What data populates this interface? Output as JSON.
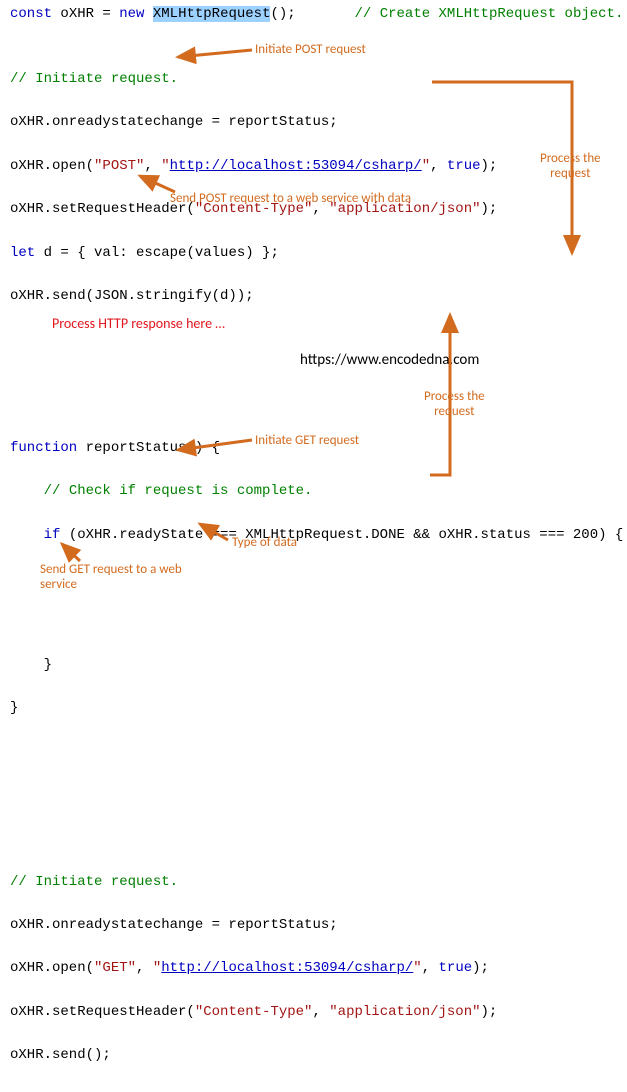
{
  "code": {
    "l1a": "const",
    "l1b": " oXHR = ",
    "l1c": "new",
    "l1d": " ",
    "l1e": "XMLHttpRequest",
    "l1f": "();",
    "l1g": "// Create XMLHttpRequest object.",
    "l3": "// Initiate request.",
    "l4": "oXHR.onreadystatechange = reportStatus;",
    "l5a": "oXHR.open(",
    "l5b": "\"POST\"",
    "l5c": ", ",
    "l5d": "\"",
    "l5url": "http://localhost:53094/csharp/",
    "l5e": "\"",
    "l5f": ", ",
    "l5g": "true",
    "l5h": ");",
    "l6a": "oXHR.setRequestHeader(",
    "l6b": "\"Content-Type\"",
    "l6c": ", ",
    "l6d": "\"application/json\"",
    "l6e": ");",
    "l7a": "let",
    "l7b": " d = { val: escape(values) };",
    "l8": "oXHR.send(JSON.stringify(d));",
    "l10a": "function",
    "l10b": " reportStatus() {",
    "l11": "// Check if request is complete.",
    "l12a": "if",
    "l12b": " (oXHR.readyState === XMLHttpRequest.DONE && oXHR.status === 200) {",
    "l15": "}",
    "l16": "}",
    "l20": "// Initiate request.",
    "l21": "oXHR.onreadystatechange = reportStatus;",
    "l22a": "oXHR.open(",
    "l22b": "\"GET\"",
    "l22c": ", ",
    "l22d": "\"",
    "l22url": "http://localhost:53094/csharp/",
    "l22e": "\"",
    "l22f": ", ",
    "l22g": "true",
    "l22h": ");",
    "l23a": "oXHR.setRequestHeader(",
    "l23b": "\"Content-Type\"",
    "l23c": ", ",
    "l23d": "\"application/json\"",
    "l23e": ");",
    "l24": "oXHR.send();"
  },
  "ann": {
    "initiatePost": "Initiate POST request",
    "processReq1": "Process the\nrequest",
    "sendPost": "Send POST request to a web service with data",
    "processHttp": "Process HTTP response here …",
    "site": "https://www.encodedna.com",
    "processReq2": "Process the\nrequest",
    "initiateGet": "Initiate GET request",
    "typeOfData": "Type of data",
    "sendGet": "Send GET request to a web\nservice"
  },
  "colors": {
    "arrow": "#d36b1f"
  }
}
